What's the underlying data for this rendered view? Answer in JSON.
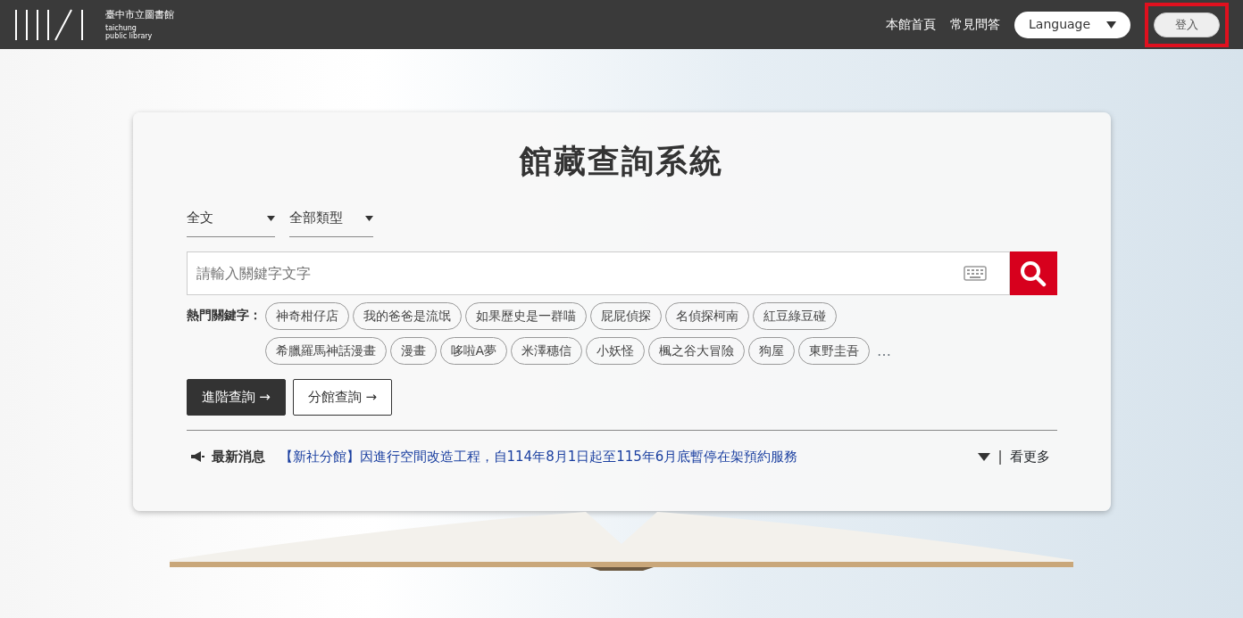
{
  "header": {
    "logo_title": "臺中市立圖書館",
    "logo_subtitle_1": "taichung",
    "logo_subtitle_2": "public library",
    "nav_links": [
      "本館首頁",
      "常見問答"
    ],
    "language": "Language",
    "login": "登入",
    "login_highlighted": true
  },
  "search_panel": {
    "title": "館藏查詢系統",
    "filters": [
      "全文",
      "全部類型"
    ],
    "search": {
      "placeholder": "請輸入關鍵字文字"
    },
    "hot_keywords_label": "熱門關鍵字：",
    "hot_keyword_rows": [
      [
        "神奇柑仔店",
        "我的爸爸是流氓",
        "如果歷史是一群喵",
        "屁屁偵探",
        "名偵探柯南",
        "紅豆綠豆碰"
      ],
      [
        "希臘羅馬神話漫畫",
        "漫畫",
        "哆啦A夢",
        "米澤穗信",
        "小妖怪",
        "楓之谷大冒險",
        "狗屋",
        "東野圭吾"
      ]
    ],
    "more_keywords": "…",
    "buttons": [
      {
        "label": "進階查詢",
        "arrow": "→",
        "kind": "dark"
      },
      {
        "label": "分館查詢",
        "arrow": "→",
        "kind": "outline"
      }
    ],
    "news": {
      "label": "最新消息",
      "headline": "【新社分館】因進行空間改造工程，自114年8月1日起至115年6月底暫停在架預約服務",
      "separator": "|",
      "more": "看更多"
    }
  }
}
